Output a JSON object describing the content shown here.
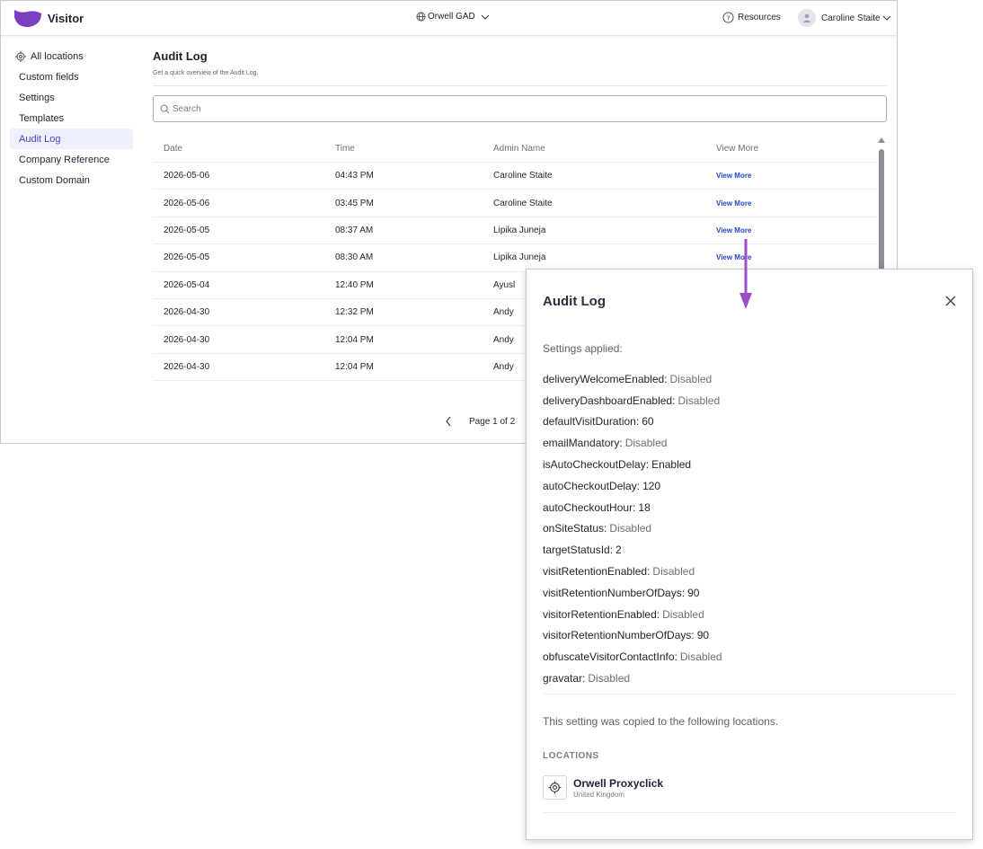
{
  "header": {
    "brand": "Visitor",
    "location": "Orwell GAD",
    "resources": "Resources",
    "user": "Caroline Staite"
  },
  "sidebar": {
    "items": [
      {
        "label": "All locations"
      },
      {
        "label": "Custom fields"
      },
      {
        "label": "Settings"
      },
      {
        "label": "Templates"
      },
      {
        "label": "Audit Log"
      },
      {
        "label": "Company Reference"
      },
      {
        "label": "Custom Domain"
      }
    ],
    "active": "Audit Log"
  },
  "main": {
    "title": "Audit Log",
    "subtitle": "Get a quick overview of the Audit Log.",
    "search_placeholder": "Search"
  },
  "table": {
    "columns": [
      "Date",
      "Time",
      "Admin Name",
      "View More"
    ],
    "rows": [
      {
        "date": "2026-05-06",
        "time": "04:43 PM",
        "admin": "Caroline Staite",
        "more": "View More"
      },
      {
        "date": "2026-05-06",
        "time": "03:45 PM",
        "admin": "Caroline Staite",
        "more": "View More"
      },
      {
        "date": "2026-05-05",
        "time": "08:37 AM",
        "admin": "Lipika Juneja",
        "more": "View More"
      },
      {
        "date": "2026-05-05",
        "time": "08:30 AM",
        "admin": "Lipika Juneja",
        "more": "View More"
      },
      {
        "date": "2026-05-04",
        "time": "12:40 PM",
        "admin": "Ayusl",
        "more": ""
      },
      {
        "date": "2026-04-30",
        "time": "12:32 PM",
        "admin": "Andy",
        "more": ""
      },
      {
        "date": "2026-04-30",
        "time": "12:04 PM",
        "admin": "Andy",
        "more": ""
      },
      {
        "date": "2026-04-30",
        "time": "12:04 PM",
        "admin": "Andy",
        "more": ""
      }
    ]
  },
  "pager": {
    "label": "Page 1 of 2"
  },
  "modal": {
    "title": "Audit Log",
    "applied_label": "Settings applied:",
    "settings": [
      {
        "key": "deliveryWelcomeEnabled:",
        "value": "Disabled"
      },
      {
        "key": "deliveryDashboardEnabled:",
        "value": "Disabled"
      },
      {
        "key": "defaultVisitDuration:",
        "value": "60"
      },
      {
        "key": "emailMandatory:",
        "value": "Disabled"
      },
      {
        "key": "isAutoCheckoutDelay:",
        "value": "Enabled"
      },
      {
        "key": "autoCheckoutDelay:",
        "value": "120"
      },
      {
        "key": "autoCheckoutHour:",
        "value": "18"
      },
      {
        "key": "onSiteStatus:",
        "value": "Disabled"
      },
      {
        "key": "targetStatusId:",
        "value": "2"
      },
      {
        "key": "visitRetentionEnabled:",
        "value": "Disabled"
      },
      {
        "key": "visitRetentionNumberOfDays:",
        "value": "90"
      },
      {
        "key": "visitorRetentionEnabled:",
        "value": "Disabled"
      },
      {
        "key": "visitorRetentionNumberOfDays:",
        "value": "90"
      },
      {
        "key": "obfuscateVisitorContactInfo:",
        "value": "Disabled"
      },
      {
        "key": "gravatar:",
        "value": "Disabled"
      }
    ],
    "copied_text": "This setting was copied to the following locations.",
    "locations_heading": "LOCATIONS",
    "location": {
      "name": "Orwell Proxyclick",
      "country": "United Kingdom"
    }
  },
  "colors": {
    "brand": "#7a3fc2",
    "accent": "#2747c9",
    "annotation_arrow": "#9b4fc7"
  }
}
